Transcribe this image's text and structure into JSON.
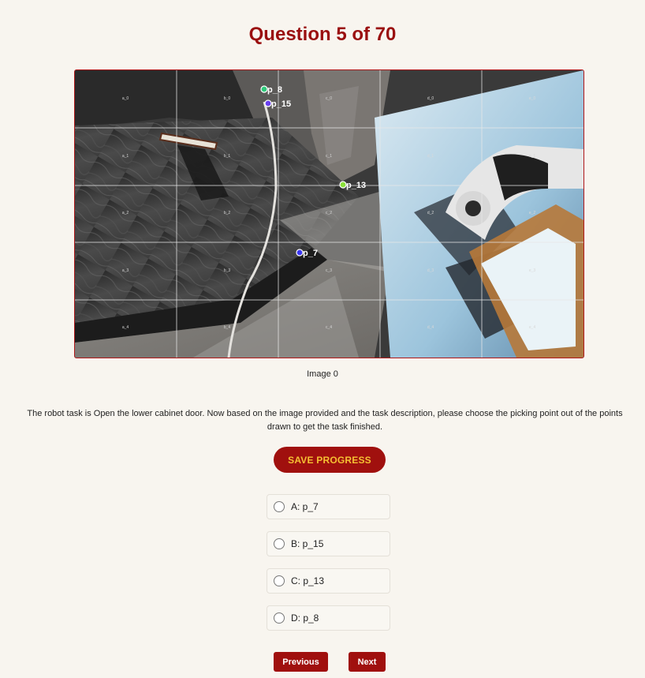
{
  "header": {
    "title": "Question 5 of 70"
  },
  "image": {
    "caption": "Image 0",
    "grid_labels": [
      [
        "a_0",
        "b_0",
        "c_0",
        "d_0",
        "e_0"
      ],
      [
        "a_1",
        "b_1",
        "c_1",
        "d_1",
        "e_1"
      ],
      [
        "a_2",
        "b_2",
        "c_2",
        "d_2",
        "e_2"
      ],
      [
        "a_3",
        "b_3",
        "c_3",
        "d_3",
        "e_3"
      ],
      [
        "a_4",
        "b_4",
        "c_4",
        "d_4",
        "e_4"
      ]
    ],
    "points": [
      {
        "label": "p_8",
        "color": "#2fc97a"
      },
      {
        "label": "p_15",
        "color": "#6a3ff0"
      },
      {
        "label": "p_13",
        "color": "#8be03a"
      },
      {
        "label": "p_7",
        "color": "#3a36f2"
      }
    ]
  },
  "prompt": "The robot task is Open the lower cabinet door. Now based on the image provided and the task description, please choose the picking point out of the points drawn to get the task finished.",
  "save_button": "SAVE PROGRESS",
  "options": [
    {
      "label": "A: p_7"
    },
    {
      "label": "B: p_15"
    },
    {
      "label": "C: p_13"
    },
    {
      "label": "D: p_8"
    }
  ],
  "nav": {
    "previous": "Previous",
    "next": "Next"
  },
  "colors": {
    "accent": "#a0100e",
    "title": "#9a0f0f",
    "save_text": "#f5c033",
    "background": "#f8f5ef"
  }
}
